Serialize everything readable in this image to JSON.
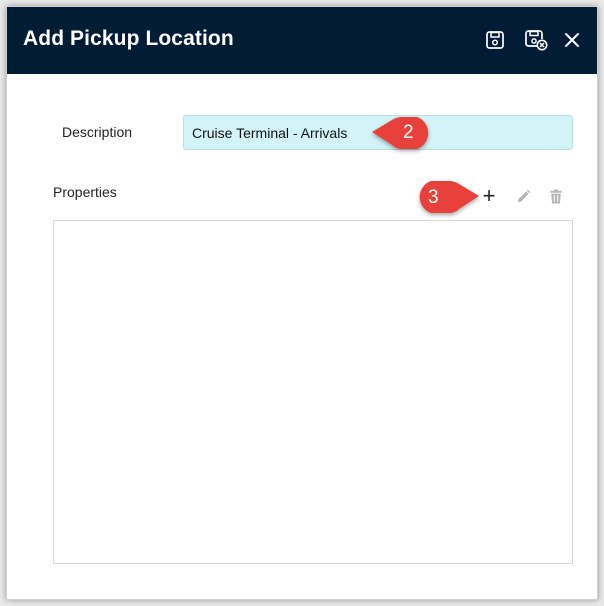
{
  "dialog": {
    "title": "Add Pickup Location",
    "icons": {
      "save": "save-icon",
      "save_close": "save-and-close-icon",
      "close": "close-icon"
    }
  },
  "form": {
    "description_label": "Description",
    "description_value": "Cruise Terminal - Arrivals",
    "properties_label": "Properties",
    "properties_tools": {
      "add": "+",
      "edit_icon": "pencil-icon",
      "delete_icon": "trash-icon"
    }
  },
  "annotations": {
    "callout_2": "2",
    "callout_3": "3",
    "callout_color": "#e8413b"
  },
  "colors": {
    "header_bg": "#031c36",
    "input_bg": "#d2f4f9"
  }
}
